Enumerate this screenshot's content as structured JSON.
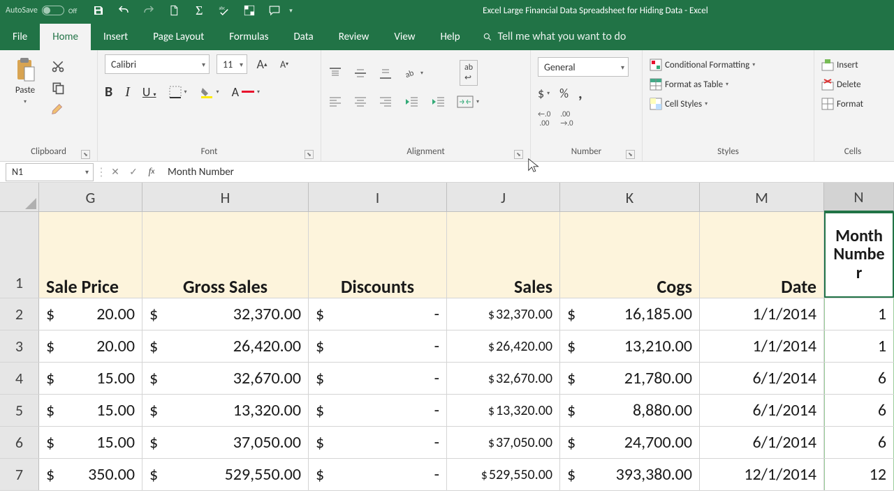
{
  "title": "Excel Large Financial Data Spreadsheet for Hiding Data  -  Excel",
  "autosave": {
    "label": "AutoSave",
    "state": "Off"
  },
  "tabs": [
    "File",
    "Home",
    "Insert",
    "Page Layout",
    "Formulas",
    "Data",
    "Review",
    "View",
    "Help"
  ],
  "active_tab": 1,
  "tellme": "Tell me what you want to do",
  "ribbon": {
    "clipboard": {
      "paste": "Paste",
      "label": "Clipboard"
    },
    "font": {
      "name": "Calibri",
      "size": "11",
      "label": "Font"
    },
    "alignment": {
      "label": "Alignment"
    },
    "number": {
      "format": "General",
      "label": "Number"
    },
    "styles": {
      "conditional": "Conditional Formatting",
      "table": "Format as Table",
      "cell_styles": "Cell Styles",
      "label": "Styles"
    },
    "cells": {
      "insert": "Insert",
      "delete": "Delete",
      "format": "Format",
      "label": "Cells"
    }
  },
  "name_box": "N1",
  "formula": "Month Number",
  "columns": [
    "G",
    "H",
    "I",
    "J",
    "K",
    "M",
    "N"
  ],
  "headers": {
    "G": "Sale Price",
    "H": "Gross Sales",
    "I": "Discounts",
    "J": "Sales",
    "K": "Cogs",
    "M": "Date",
    "N": "Month Number"
  },
  "rows": [
    {
      "n": 2,
      "G": "20.00",
      "H": "32,370.00",
      "I": "-",
      "J": "32,370.00",
      "K": "16,185.00",
      "M": "1/1/2014",
      "N": "1"
    },
    {
      "n": 3,
      "G": "20.00",
      "H": "26,420.00",
      "I": "-",
      "J": "26,420.00",
      "K": "13,210.00",
      "M": "1/1/2014",
      "N": "1"
    },
    {
      "n": 4,
      "G": "15.00",
      "H": "32,670.00",
      "I": "-",
      "J": "32,670.00",
      "K": "21,780.00",
      "M": "6/1/2014",
      "N": "6"
    },
    {
      "n": 5,
      "G": "15.00",
      "H": "13,320.00",
      "I": "-",
      "J": "13,320.00",
      "K": "8,880.00",
      "M": "6/1/2014",
      "N": "6"
    },
    {
      "n": 6,
      "G": "15.00",
      "H": "37,050.00",
      "I": "-",
      "J": "37,050.00",
      "K": "24,700.00",
      "M": "6/1/2014",
      "N": "6"
    },
    {
      "n": 7,
      "G": "350.00",
      "H": "529,550.00",
      "I": "-",
      "J": "529,550.00",
      "K": "393,380.00",
      "M": "12/1/2014",
      "N": "12"
    }
  ]
}
